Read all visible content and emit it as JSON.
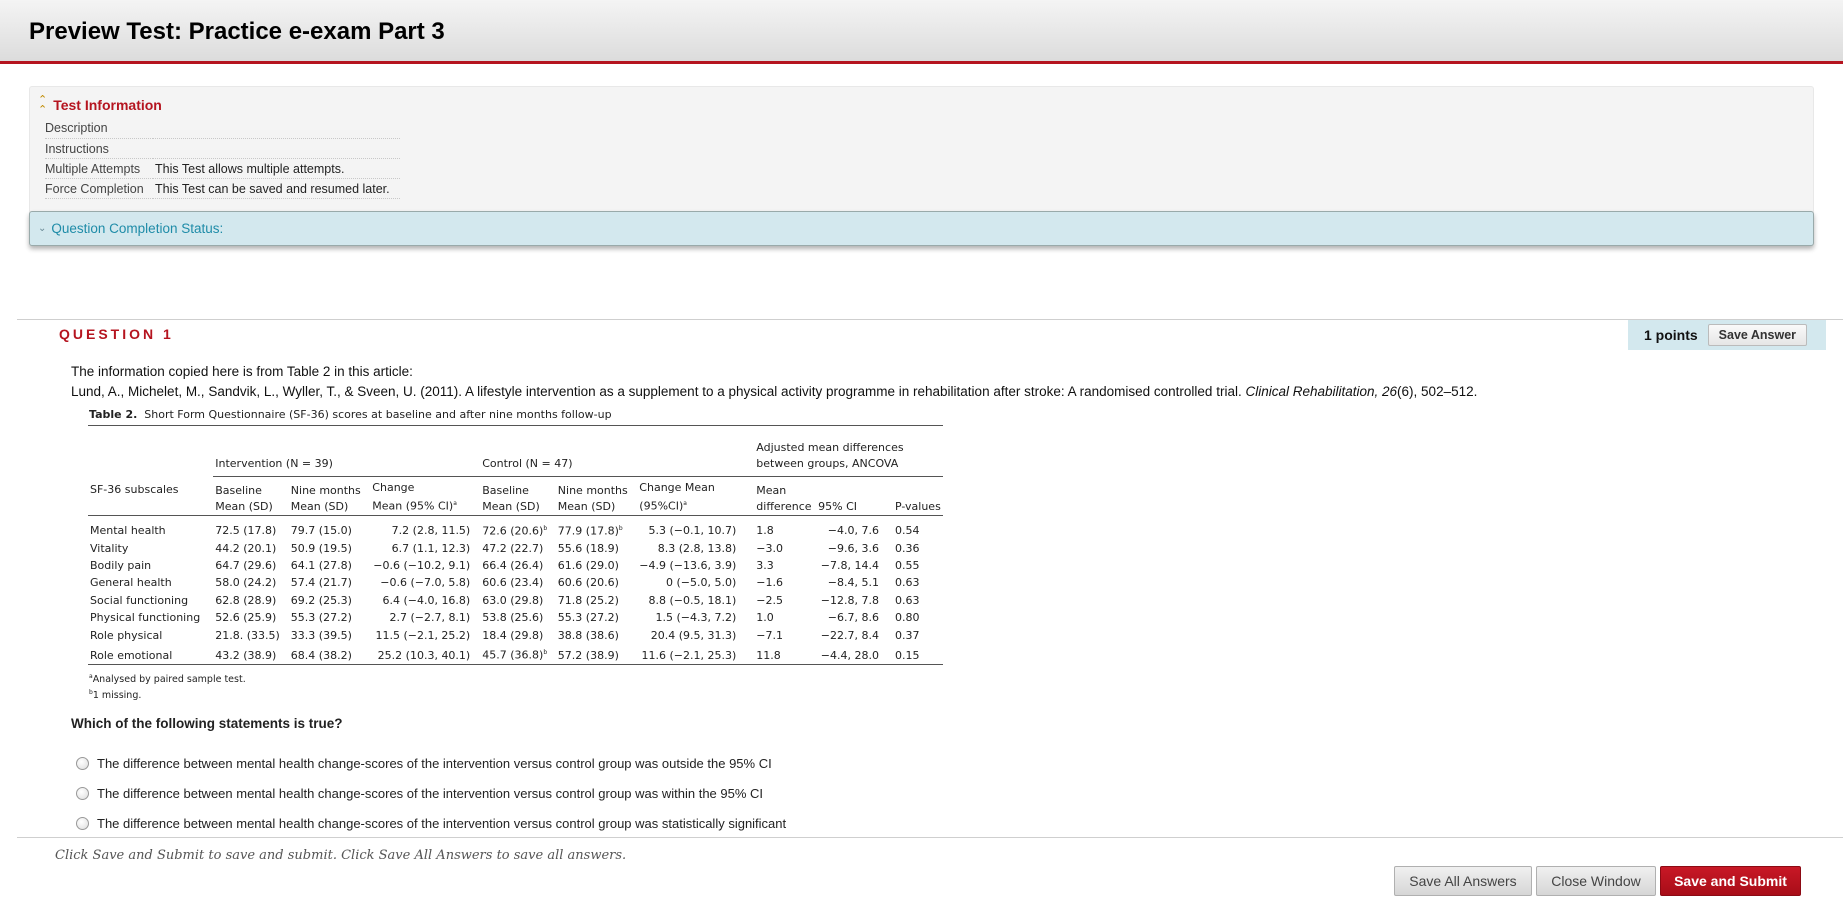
{
  "page": {
    "title": "Preview Test: Practice e-exam Part 3"
  },
  "test_info": {
    "toggle_label": "Test Information",
    "toggle_icon": "double-chevron-up-icon",
    "rows": [
      {
        "label": "Description",
        "value": ""
      },
      {
        "label": "Instructions",
        "value": ""
      },
      {
        "label": "Multiple Attempts",
        "value": "This Test allows multiple attempts."
      },
      {
        "label": "Force Completion",
        "value": "This Test can be saved and resumed later."
      }
    ]
  },
  "completion_status": {
    "label": "Question Completion Status:",
    "icon": "double-chevron-down-icon"
  },
  "question": {
    "title": "QUESTION 1",
    "points": "1 points",
    "save_answer_label": "Save Answer",
    "intro_line": "The information copied here is from Table 2 in this article:",
    "citation_main": "Lund, A., Michelet, M., Sandvik, L., Wyller, T., & Sveen, U. (2011). A lifestyle intervention as a supplement to a physical activity programme in rehabilitation after stroke: A randomised controlled trial. ",
    "citation_journal": "Clinical Rehabilitation, 26",
    "citation_tail": "(6), 502–512.",
    "prompt": "Which of the following statements is true?",
    "options": [
      "The difference between mental health change-scores of the intervention versus control group was outside the 95% CI",
      "The difference between mental health change-scores of the intervention versus control group was within the 95% CI",
      "The difference between mental health change-scores of the intervention versus control group was statistically significant"
    ],
    "selected_option": null
  },
  "table": {
    "caption_label": "Table 2.",
    "caption_text": "Short Form Questionnaire (SF-36) scores at baseline and after nine months follow-up",
    "group_intervention": "Intervention (N = 39)",
    "group_control": "Control (N = 47)",
    "group_ancova_1": "Adjusted mean differences",
    "group_ancova_2": "between groups, ANCOVA",
    "col_subscale": "SF-36 subscales",
    "headers": {
      "i_base_1": "Baseline",
      "i_base_2": "Mean (SD)",
      "i_nine_1": "Nine months",
      "i_nine_2": "Mean (SD)",
      "i_change_1": "Change",
      "i_change_2": "Mean (95% CI)",
      "c_base_1": "Baseline",
      "c_base_2": "Mean (SD)",
      "c_nine_1": "Nine months",
      "c_nine_2": "Mean (SD)",
      "c_change_1": "Change Mean",
      "c_change_2": "(95%CI)",
      "md_1": "Mean",
      "md_2": "difference",
      "ci": "95% CI",
      "p": "P-values"
    },
    "rows": [
      {
        "subscale": "Mental health",
        "i_base": "72.5 (17.8)",
        "i_nine": "79.7 (15.0)",
        "i_change": "7.2 (2.8, 11.5)",
        "c_base": "72.6 (20.6)",
        "c_base_sup": "b",
        "c_nine": "77.9 (17.8)",
        "c_nine_sup": "b",
        "c_change": "5.3 (−0.1, 10.7)",
        "md": "1.8",
        "ci": "−4.0, 7.6",
        "p": "0.54"
      },
      {
        "subscale": "Vitality",
        "i_base": "44.2 (20.1)",
        "i_nine": "50.9 (19.5)",
        "i_change": "6.7 (1.1, 12.3)",
        "c_base": "47.2 (22.7)",
        "c_base_sup": "",
        "c_nine": "55.6 (18.9)",
        "c_nine_sup": "",
        "c_change": "8.3 (2.8, 13.8)",
        "md": "−3.0",
        "ci": "−9.6, 3.6",
        "p": "0.36"
      },
      {
        "subscale": "Bodily pain",
        "i_base": "64.7 (29.6)",
        "i_nine": "64.1 (27.8)",
        "i_change": "−0.6 (−10.2, 9.1)",
        "c_base": "66.4 (26.4)",
        "c_base_sup": "",
        "c_nine": "61.6 (29.0)",
        "c_nine_sup": "",
        "c_change": "−4.9 (−13.6, 3.9)",
        "md": "3.3",
        "ci": "−7.8, 14.4",
        "p": "0.55"
      },
      {
        "subscale": "General health",
        "i_base": "58.0 (24.2)",
        "i_nine": "57.4 (21.7)",
        "i_change": "−0.6 (−7.0, 5.8)",
        "c_base": "60.6 (23.4)",
        "c_base_sup": "",
        "c_nine": "60.6 (20.6)",
        "c_nine_sup": "",
        "c_change": "0 (−5.0, 5.0)",
        "md": "−1.6",
        "ci": "−8.4, 5.1",
        "p": "0.63"
      },
      {
        "subscale": "Social functioning",
        "i_base": "62.8 (28.9)",
        "i_nine": "69.2 (25.3)",
        "i_change": "6.4 (−4.0, 16.8)",
        "c_base": "63.0 (29.8)",
        "c_base_sup": "",
        "c_nine": "71.8 (25.2)",
        "c_nine_sup": "",
        "c_change": "8.8 (−0.5, 18.1)",
        "md": "−2.5",
        "ci": "−12.8, 7.8",
        "p": "0.63"
      },
      {
        "subscale": "Physical functioning",
        "i_base": "52.6 (25.9)",
        "i_nine": "55.3 (27.2)",
        "i_change": "2.7 (−2.7, 8.1)",
        "c_base": "53.8 (25.6)",
        "c_base_sup": "",
        "c_nine": "55.3 (27.2)",
        "c_nine_sup": "",
        "c_change": "1.5 (−4.3, 7.2)",
        "md": "1.0",
        "ci": "−6.7, 8.6",
        "p": "0.80"
      },
      {
        "subscale": "Role physical",
        "i_base": "21.8. (33.5)",
        "i_nine": "33.3 (39.5)",
        "i_change": "11.5 (−2.1, 25.2)",
        "c_base": "18.4 (29.8)",
        "c_base_sup": "",
        "c_nine": "38.8 (38.6)",
        "c_nine_sup": "",
        "c_change": "20.4 (9.5, 31.3)",
        "md": "−7.1",
        "ci": "−22.7, 8.4",
        "p": "0.37"
      },
      {
        "subscale": "Role emotional",
        "i_base": "43.2 (38.9)",
        "i_nine": "68.4 (38.2)",
        "i_change": "25.2 (10.3, 40.1)",
        "c_base": "45.7 (36.8)",
        "c_base_sup": "b",
        "c_nine": "57.2 (38.9)",
        "c_nine_sup": "",
        "c_change": "11.6 (−2.1, 25.3)",
        "md": "11.8",
        "ci": "−4.4, 28.0",
        "p": "0.15"
      }
    ],
    "footnote_a": "Analysed by paired sample test.",
    "footnote_b": "1 missing."
  },
  "footer": {
    "note": "Click Save and Submit to save and submit. Click Save All Answers to save all answers.",
    "save_all_label": "Save All Answers",
    "close_label": "Close Window",
    "submit_label": "Save and Submit"
  },
  "colors": {
    "accent_red": "#b5141f",
    "status_bar_bg": "#d3e8ee",
    "status_text": "#1f8ca8"
  }
}
